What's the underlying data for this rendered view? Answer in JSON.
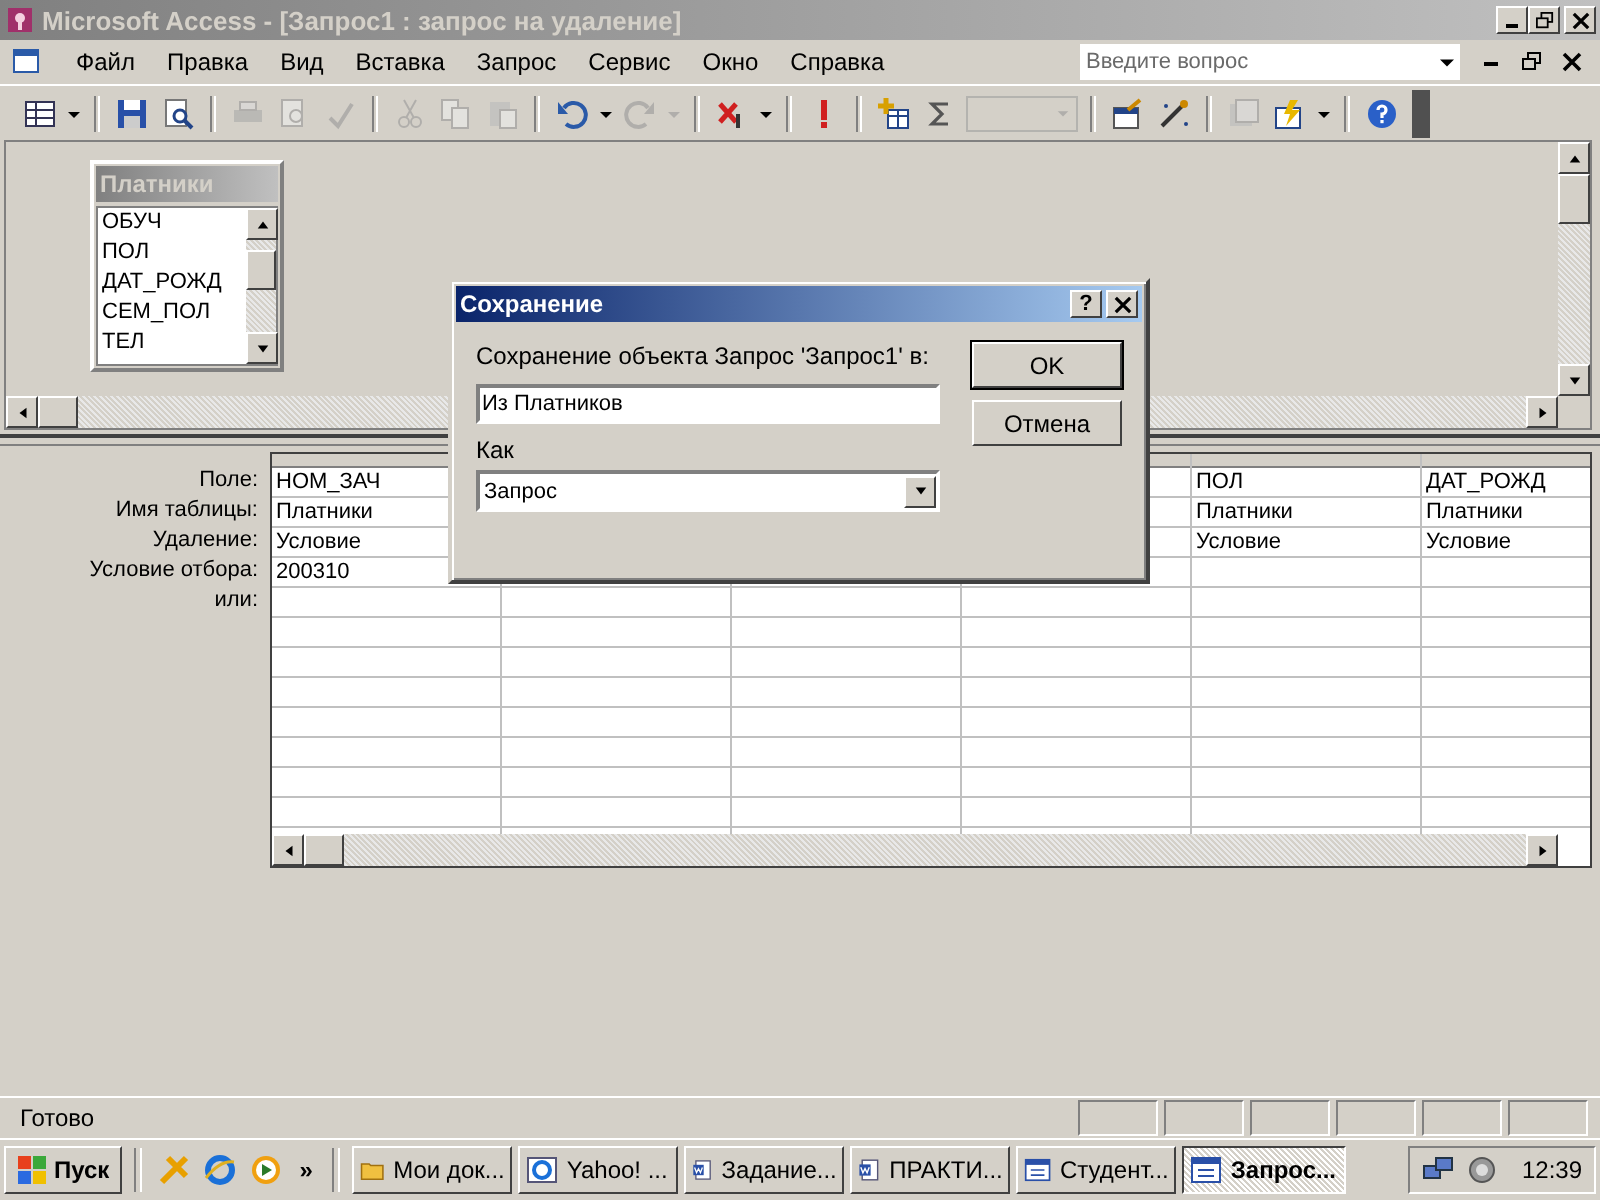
{
  "window": {
    "title": "Microsoft Access - [Запрос1 : запрос на удаление]"
  },
  "menu": [
    "Файл",
    "Правка",
    "Вид",
    "Вставка",
    "Запрос",
    "Сервис",
    "Окно",
    "Справка"
  ],
  "help_box": {
    "placeholder": "Введите вопрос"
  },
  "field_list": {
    "title": "Платники",
    "fields": [
      "ОБУЧ",
      "ПОЛ",
      "ДАТ_РОЖД",
      "СЕМ_ПОЛ",
      "ТЕЛ"
    ]
  },
  "grid": {
    "row_labels": [
      "Поле:",
      "Имя таблицы:",
      "Удаление:",
      "Условие отбора:",
      "или:"
    ],
    "columns": [
      {
        "cells": [
          "НОМ_ЗАЧ",
          "Платники",
          "Условие",
          "200310"
        ]
      },
      {},
      {},
      {},
      {
        "cells": [
          "ПОЛ",
          "Платники",
          "Условие"
        ]
      },
      {
        "cells": [
          "ДАТ_РОЖД",
          "Платники",
          "Условие"
        ]
      }
    ]
  },
  "dialog": {
    "title": "Сохранение",
    "help": "?",
    "prompt": "Сохранение объекта Запрос 'Запрос1' в:",
    "name_value": "Из Платников",
    "as_label": "Как",
    "as_value": "Запрос",
    "buttons": [
      "OK",
      "Отмена"
    ]
  },
  "status_bar": {
    "text": "Готово"
  },
  "taskbar": {
    "start": "Пуск",
    "more": "»",
    "clock": "12:39",
    "items": [
      {
        "label": "Мои док...",
        "kind": "folder",
        "selected": false
      },
      {
        "label": "Yahoo! ...",
        "kind": "browser",
        "selected": false
      },
      {
        "label": "Задание...",
        "kind": "document",
        "selected": false
      },
      {
        "label": "ПРАКТИ...",
        "kind": "document",
        "selected": false
      },
      {
        "label": "Студент...",
        "kind": "database",
        "selected": false
      },
      {
        "label": "Запрос...",
        "kind": "database",
        "selected": true
      }
    ]
  }
}
